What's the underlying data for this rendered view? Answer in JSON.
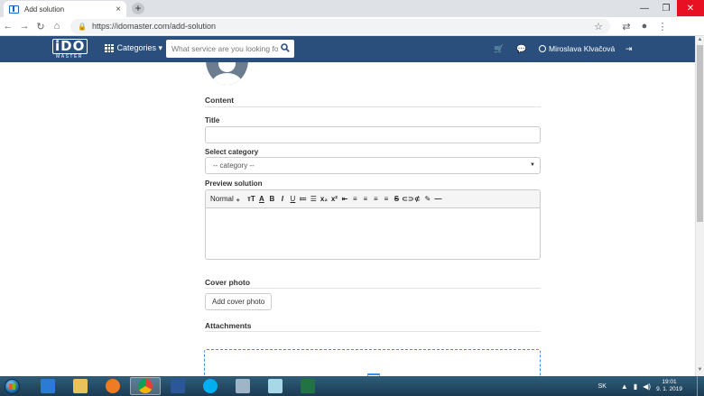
{
  "browser": {
    "tab_title": "Add solution",
    "tab_close": "×",
    "new_tab": "+",
    "url": "https://idomaster.com/add-solution",
    "window_controls": {
      "minimize": "—",
      "maximize": "❐",
      "close": "✕"
    }
  },
  "header": {
    "logo_big": "iDO",
    "logo_small": "MASTER",
    "categories_label": "Categories ▾",
    "search_placeholder": "What service are you looking for?",
    "user_name": "Miroslava Klvačová"
  },
  "form": {
    "content_title": "Content",
    "title_label": "Title",
    "title_value": "",
    "category_label": "Select category",
    "category_selected": "-- category --",
    "preview_label": "Preview solution",
    "editor_format": "Normal",
    "editor_buttons": [
      "ᴛT",
      "A",
      "B",
      "I",
      "U",
      "≔",
      "☰",
      "x₂",
      "x²",
      "⇤",
      "≡",
      "≡",
      "≡",
      "≡",
      "S",
      "⊂⊃",
      "⊄",
      "✎",
      "—"
    ],
    "cover_title": "Cover photo",
    "cover_button": "Add cover photo",
    "attachments_title": "Attachments"
  },
  "taskbar": {
    "language": "SK",
    "time": "19:01",
    "date": "9. 1. 2019",
    "apps": [
      {
        "name": "internet-explorer",
        "color": "#2b7bd6"
      },
      {
        "name": "file-explorer",
        "color": "#e8c25a"
      },
      {
        "name": "media-player",
        "color": "#f07b22"
      },
      {
        "name": "chrome",
        "color": "#db4437"
      },
      {
        "name": "word",
        "color": "#2b579a"
      },
      {
        "name": "skype",
        "color": "#00aff0"
      },
      {
        "name": "calculator",
        "color": "#9fb4c7"
      },
      {
        "name": "notepad",
        "color": "#a8d8e8"
      },
      {
        "name": "excel",
        "color": "#217346"
      }
    ]
  }
}
